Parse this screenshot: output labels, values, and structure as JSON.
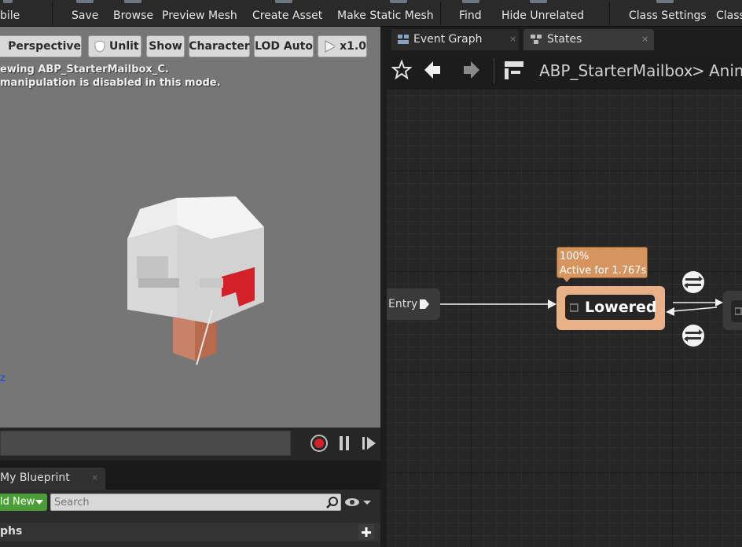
{
  "toolbar": {
    "items": [
      {
        "label": "bile"
      },
      {
        "label": "Save"
      },
      {
        "label": "Browse"
      },
      {
        "label": "Preview Mesh"
      },
      {
        "label": "Create Asset"
      },
      {
        "label": "Make Static Mesh"
      },
      {
        "label": "Find"
      },
      {
        "label": "Hide Unrelated"
      },
      {
        "label": "Class Settings"
      },
      {
        "label": "Class"
      }
    ]
  },
  "viewport": {
    "buttons": {
      "perspective": "Perspective",
      "unlit": "Unlit",
      "show": "Show",
      "character": "Character",
      "lod": "LOD Auto",
      "speed": "x1.0"
    },
    "message_line1": "ewing ABP_StarterMailbox_C.",
    "message_line2": "manipulation is disabled in this mode.",
    "axis_label": "z"
  },
  "my_blueprint": {
    "tab_label": "My Blueprint",
    "add_new_label": "ld New",
    "search_placeholder": "Search",
    "section_label": "phs"
  },
  "graph": {
    "tabs": [
      {
        "label": "Event Graph"
      },
      {
        "label": "States"
      }
    ],
    "breadcrumb": {
      "root": "ABP_StarterMailbox",
      "separator": ">",
      "current": "Anim"
    },
    "entry_label": "Entry",
    "tooltip_weight": "100%",
    "tooltip_active": "Active for 1.767s",
    "state_name": "Lowered"
  },
  "colors": {
    "state_node": "#e8b188",
    "tooltip": "#d6955f",
    "add_new": "#4b9e37",
    "mailbox_flag": "#d42028",
    "record": "#d42028"
  }
}
